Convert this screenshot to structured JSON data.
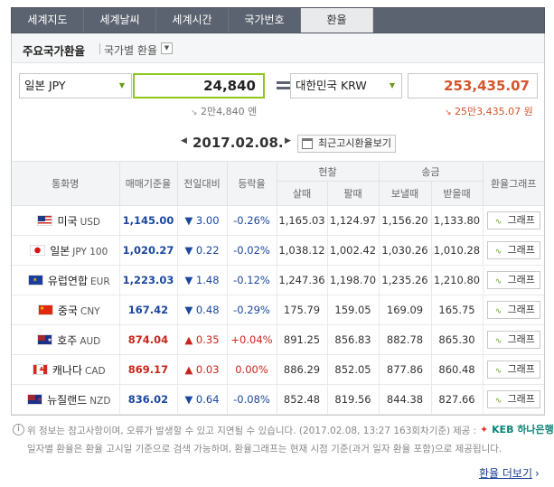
{
  "tabs": [
    "세계지도",
    "세계날씨",
    "세계시간",
    "국가번호",
    "환율"
  ],
  "active_tab": "환율",
  "subheader": {
    "title": "주요국가환율",
    "option": "국가별 환율"
  },
  "converter": {
    "from_currency": "일본 JPY",
    "from_amount": "24,840",
    "to_currency": "대한민국 KRW",
    "to_amount": "253,435.07",
    "from_hint": "2만4,840 엔",
    "to_hint": "25만3,435.07 원",
    "hint_arrow": "↘"
  },
  "date": {
    "value": "2017.02.08.",
    "prev": "◀",
    "next": "▶",
    "recent_button": "최근고시환율보기"
  },
  "table": {
    "headers": {
      "currency": "통화명",
      "base": "매매기준율",
      "change": "전일대비",
      "rate": "등락율",
      "cash": "현찰",
      "cash_buy": "살때",
      "cash_sell": "팔때",
      "transfer": "송금",
      "transfer_send": "보낼때",
      "transfer_receive": "받을때",
      "graph": "환율그래프"
    },
    "rows": [
      {
        "name": "미국",
        "code": "USD",
        "base": "1,145.00",
        "change": "▼ 3.00",
        "rate": "-0.26%",
        "cash_buy": "1,165.03",
        "cash_sell": "1,124.97",
        "send": "1,156.20",
        "receive": "1,133.80",
        "graph": "그래프",
        "dir": "down"
      },
      {
        "name": "일본",
        "code": "JPY 100",
        "base": "1,020.27",
        "change": "▼ 0.22",
        "rate": "-0.02%",
        "cash_buy": "1,038.12",
        "cash_sell": "1,002.42",
        "send": "1,030.26",
        "receive": "1,010.28",
        "graph": "그래프",
        "dir": "down"
      },
      {
        "name": "유럽연합",
        "code": "EUR",
        "base": "1,223.03",
        "change": "▼ 1.48",
        "rate": "-0.12%",
        "cash_buy": "1,247.36",
        "cash_sell": "1,198.70",
        "send": "1,235.26",
        "receive": "1,210.80",
        "graph": "그래프",
        "dir": "down"
      },
      {
        "name": "중국",
        "code": "CNY",
        "base": "167.42",
        "change": "▼ 0.48",
        "rate": "-0.29%",
        "cash_buy": "175.79",
        "cash_sell": "159.05",
        "send": "169.09",
        "receive": "165.75",
        "graph": "그래프",
        "dir": "down"
      },
      {
        "name": "호주",
        "code": "AUD",
        "base": "874.04",
        "change": "▲ 0.35",
        "rate": "+0.04%",
        "cash_buy": "891.25",
        "cash_sell": "856.83",
        "send": "882.78",
        "receive": "865.30",
        "graph": "그래프",
        "dir": "up"
      },
      {
        "name": "캐나다",
        "code": "CAD",
        "base": "869.17",
        "change": "▲ 0.03",
        "rate": "0.00%",
        "cash_buy": "886.29",
        "cash_sell": "852.05",
        "send": "877.86",
        "receive": "860.48",
        "graph": "그래프",
        "dir": "up"
      },
      {
        "name": "뉴질랜드",
        "code": "NZD",
        "base": "836.02",
        "change": "▼ 0.64",
        "rate": "-0.08%",
        "cash_buy": "852.48",
        "cash_sell": "819.56",
        "send": "844.38",
        "receive": "827.66",
        "graph": "그래프",
        "dir": "down"
      }
    ]
  },
  "notes": {
    "line1": "위 정보는 참고사항이며, 오류가 발생할 수 있고 지연될 수 있습니다. (2017.02.08, 13:27 163회차기준)",
    "line2": "일자별 환율은 환율 고시일 기준으로 검색 가능하며, 환율그래프는 현재 시점 기준(과거 일자 환율 포함)으로 제공됩니다.",
    "provider_label": "제공 :",
    "provider": "KEB 하나은행"
  },
  "more_link": "환율 더보기",
  "colors": {
    "tab_bg": "#5c6370",
    "accent_green": "#8ec71b",
    "up": "#c8261c",
    "down": "#1b47a0",
    "krw_amount": "#d4552b"
  },
  "icons": {
    "dropdown": "chevron-down-icon",
    "calendar": "calendar-icon",
    "graph": "graph-icon",
    "info": "info-icon"
  }
}
